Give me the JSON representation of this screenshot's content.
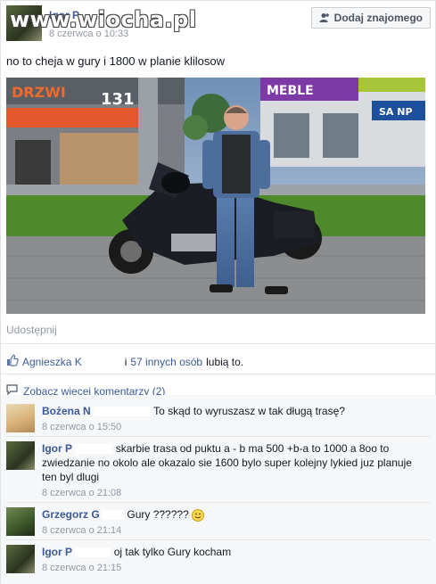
{
  "post": {
    "author": "Igor P",
    "timestamp": "8 czerwca o 10:33",
    "watermark": "www.wiocha.pl",
    "add_friend_label": "Dodaj znajomego",
    "text": "no to cheja w gury i 1800 w planie klilosow",
    "share_label": "Udostępnij"
  },
  "photo": {
    "sign_left": "DRZWI",
    "sign_number": "131",
    "sign_meble": "MEBLE",
    "sign_right": "SA NP"
  },
  "likes": {
    "name": "Agnieszka K",
    "others": "57 innych osób",
    "suffix": "lubią to.",
    "conjunction": "i"
  },
  "more_comments": "Zobacz więcej komentarzy (2)",
  "comments": [
    {
      "name": "Bożena N",
      "text": "To skąd to wyruszasz w tak długą trasę?",
      "time": "8 czerwca o 15:50"
    },
    {
      "name": "Igor P",
      "text": "skarbie trasa od puktu a - b ma 500 +b-a to 1000 a 8oo to zwiedzanie no okolo ale okazalo sie 1600 bylo super kolejny lykied juz planuje ten byl dlugi",
      "time": "8 czerwca o 21:08"
    },
    {
      "name": "Grzegorz G",
      "text": "Gury ??????",
      "time": "8 czerwca o 21:14"
    },
    {
      "name": "Igor P",
      "text": "oj tak tylko Gury kocham",
      "time": "8 czerwca o 21:15"
    }
  ]
}
